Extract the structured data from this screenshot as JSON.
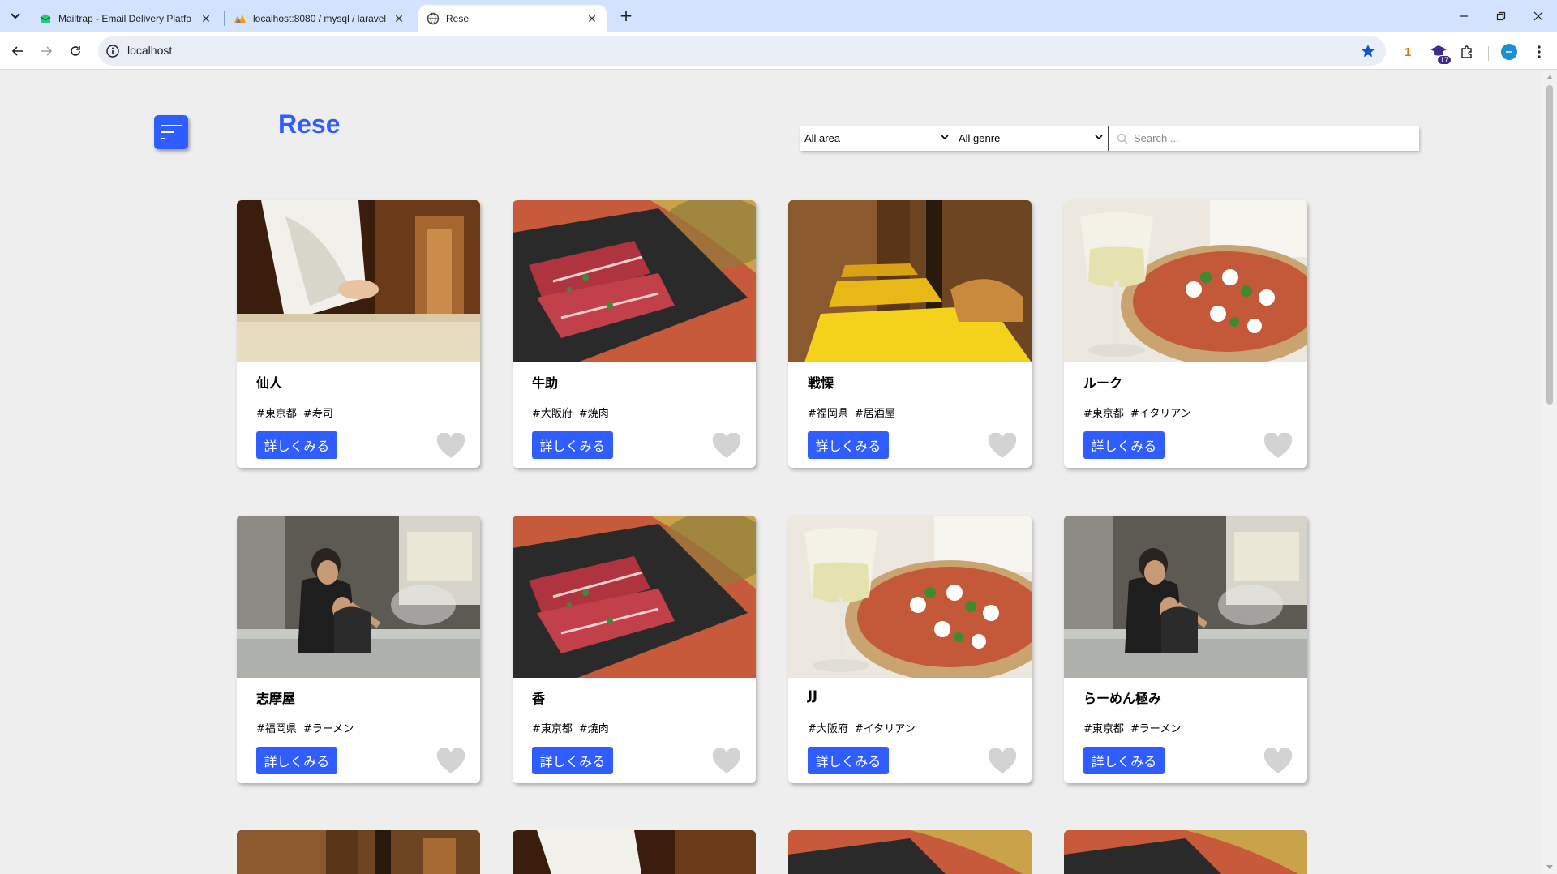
{
  "browser": {
    "tabs": [
      {
        "title": "Mailtrap - Email Delivery Platfo",
        "icon": "mailtrap-icon",
        "active": false
      },
      {
        "title": "localhost:8080 / mysql / laravel",
        "icon": "phpmyadmin-icon",
        "active": false
      },
      {
        "title": "Rese",
        "icon": "globe-icon",
        "active": true
      }
    ],
    "url": "localhost",
    "extension_badge": "1",
    "notification_count": "17"
  },
  "page": {
    "brand": "Rese",
    "filters": {
      "area": "All area",
      "genre": "All genre",
      "search_placeholder": "Search ..."
    },
    "accent_color": "#305dff",
    "detail_label": "詳しくみる",
    "shops": [
      {
        "name": "仙人",
        "area": "#東京都",
        "genre": "#寿司",
        "image": "sushi-chef-photo"
      },
      {
        "name": "牛助",
        "area": "#大阪府",
        "genre": "#焼肉",
        "image": "yakiniku-beef-photo"
      },
      {
        "name": "戦慄",
        "area": "#福岡県",
        "genre": "#居酒屋",
        "image": "izakaya-interior-photo"
      },
      {
        "name": "ルーク",
        "area": "#東京都",
        "genre": "#イタリアン",
        "image": "pizza-wine-photo"
      },
      {
        "name": "志摩屋",
        "area": "#福岡県",
        "genre": "#ラーメン",
        "image": "ramen-kitchen-photo"
      },
      {
        "name": "香",
        "area": "#東京都",
        "genre": "#焼肉",
        "image": "yakiniku-beef-photo"
      },
      {
        "name": "JJ",
        "area": "#大阪府",
        "genre": "#イタリアン",
        "image": "pizza-wine-photo"
      },
      {
        "name": "らーめん極み",
        "area": "#東京都",
        "genre": "#ラーメン",
        "image": "ramen-kitchen-photo"
      }
    ]
  }
}
